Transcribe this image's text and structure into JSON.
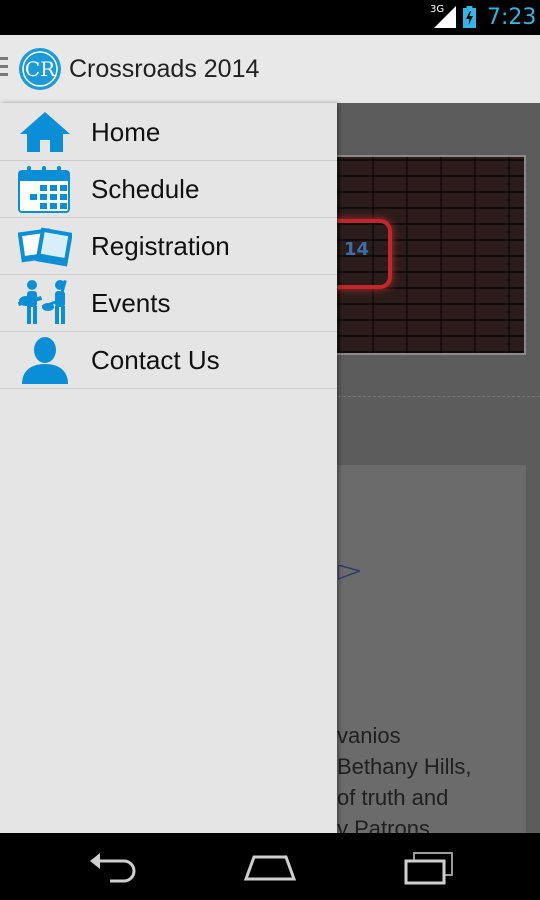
{
  "status_bar": {
    "network": "3G",
    "time": "7:23",
    "icons": [
      "signal-icon",
      "battery-charging-icon"
    ]
  },
  "action_bar": {
    "logo_text": "CR",
    "title": "Crossroads 2014"
  },
  "drawer": {
    "items": [
      {
        "label": "Home",
        "icon": "home-icon"
      },
      {
        "label": "Schedule",
        "icon": "calendar-icon"
      },
      {
        "label": "Registration",
        "icon": "photos-icon"
      },
      {
        "label": "Events",
        "icon": "band-icon"
      },
      {
        "label": "Contact Us",
        "icon": "person-icon"
      }
    ]
  },
  "background": {
    "banner_text": "14",
    "text_lines": [
      "vanios",
      "Bethany Hills,",
      "of truth and",
      "y Patrons."
    ]
  },
  "nav_bar": {
    "icons": [
      "back-icon",
      "home-nav-icon",
      "recent-apps-icon"
    ]
  },
  "colors": {
    "accent": "#0a8fd6",
    "status_time": "#33b5e5",
    "drawer_bg": "#e5e5e5",
    "action_bar_bg": "#e8e8e8"
  }
}
